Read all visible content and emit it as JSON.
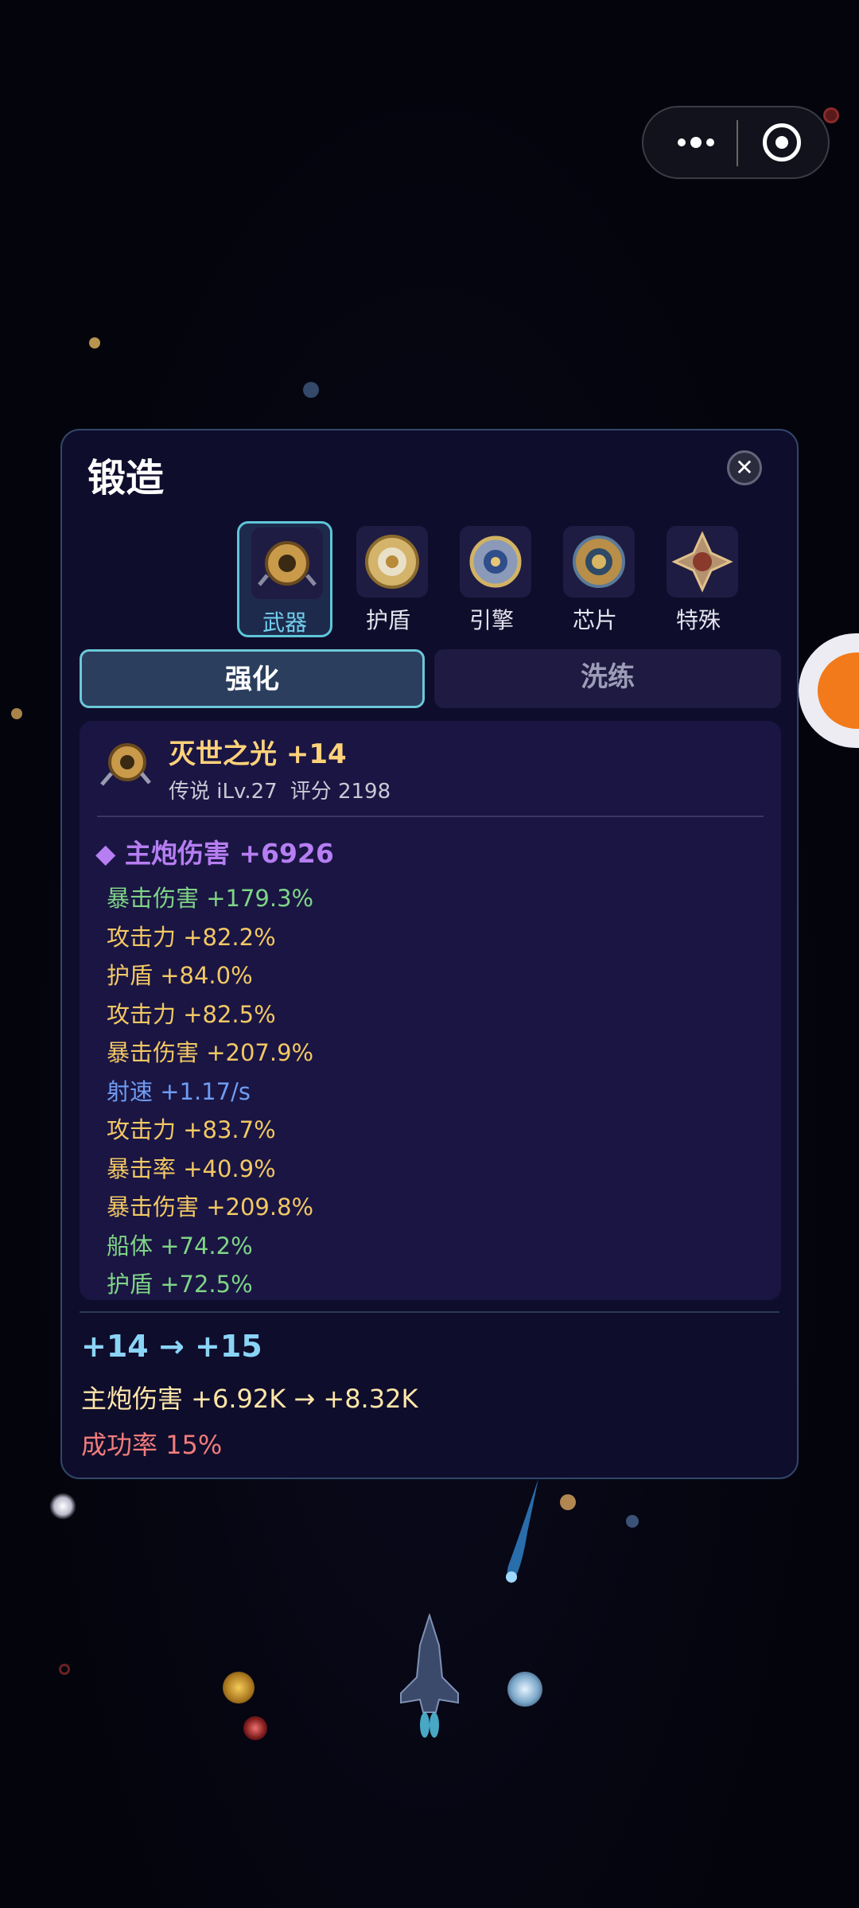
{
  "capsule": {
    "more_icon": "more-dots-icon",
    "target_icon": "target-icon"
  },
  "panel": {
    "title": "锻造",
    "close_icon": "close-icon",
    "categories": [
      {
        "label": "武器",
        "icon": "weapon-icon",
        "active": true
      },
      {
        "label": "护盾",
        "icon": "shield-icon",
        "active": false
      },
      {
        "label": "引擎",
        "icon": "engine-icon",
        "active": false
      },
      {
        "label": "芯片",
        "icon": "chip-icon",
        "active": false
      },
      {
        "label": "特殊",
        "icon": "special-icon",
        "active": false
      }
    ],
    "tabs": {
      "enhance": "强化",
      "reforge": "洗练"
    },
    "item": {
      "name": "灭世之光 +14",
      "rarity_level": "传说 iLv.27",
      "score": "评分 2198",
      "main_stat": "◆ 主炮伤害 +6926",
      "stats": [
        {
          "text": "暴击伤害 +179.3%",
          "color": "#7fd486"
        },
        {
          "text": "攻击力 +82.2%",
          "color": "#f2c864"
        },
        {
          "text": "护盾 +84.0%",
          "color": "#f2c864"
        },
        {
          "text": "攻击力 +82.5%",
          "color": "#f2c864"
        },
        {
          "text": "暴击伤害 +207.9%",
          "color": "#f2c864"
        },
        {
          "text": "射速 +1.17/s",
          "color": "#6f9cf0"
        },
        {
          "text": "攻击力 +83.7%",
          "color": "#f2c864"
        },
        {
          "text": "暴击率 +40.9%",
          "color": "#f2c864"
        },
        {
          "text": "暴击伤害 +209.8%",
          "color": "#f2c864"
        },
        {
          "text": "船体 +74.2%",
          "color": "#7fd486"
        },
        {
          "text": "护盾 +72.5%",
          "color": "#7fd486"
        }
      ]
    },
    "upgrade": {
      "level_change": "+14 → +15",
      "damage_change": "主炮伤害 +6.92K → +8.32K",
      "success_rate": "成功率 15%"
    }
  },
  "colors": {
    "accent": "#5ec6d8",
    "legend_gold": "#ffd27a",
    "main_stat": "#b67ef2",
    "fail_red": "#f07c7c"
  }
}
